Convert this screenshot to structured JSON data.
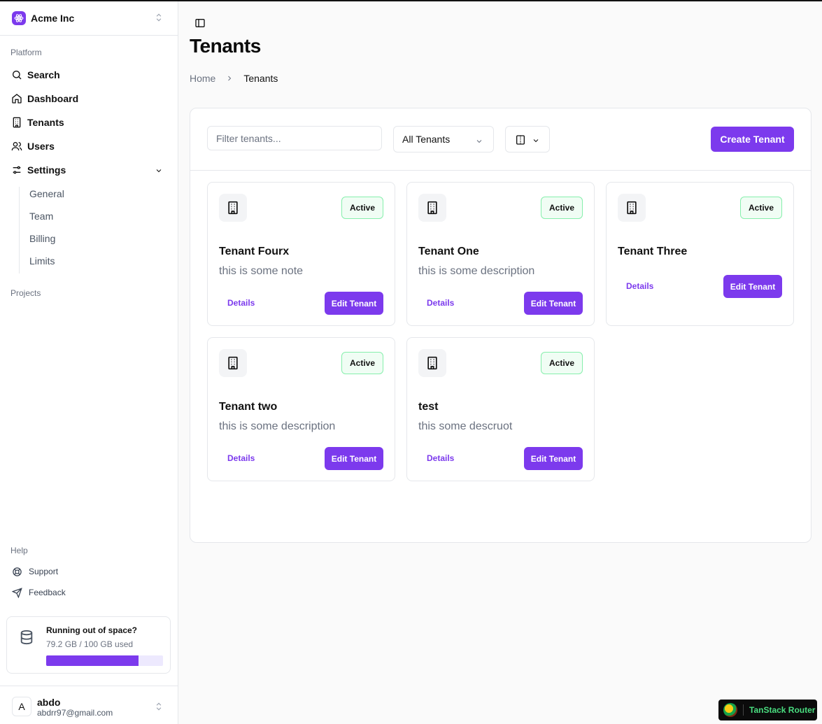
{
  "org": {
    "name": "Acme Inc"
  },
  "sidebar": {
    "platform_label": "Platform",
    "items": [
      {
        "label": "Search",
        "icon": "search-icon"
      },
      {
        "label": "Dashboard",
        "icon": "home-icon"
      },
      {
        "label": "Tenants",
        "icon": "building-icon"
      },
      {
        "label": "Users",
        "icon": "users-icon"
      },
      {
        "label": "Settings",
        "icon": "settings-sliders-icon"
      }
    ],
    "settings_sub": [
      "General",
      "Team",
      "Billing",
      "Limits"
    ],
    "projects_label": "Projects",
    "help_label": "Help",
    "help_items": [
      {
        "label": "Support",
        "icon": "life-buoy-icon"
      },
      {
        "label": "Feedback",
        "icon": "send-icon"
      }
    ],
    "storage": {
      "title": "Running out of space?",
      "usage": "79.2 GB / 100 GB used",
      "fraction": 0.792
    },
    "user": {
      "initial": "A",
      "name": "abdo",
      "email": "abdrr97@gmail.com"
    }
  },
  "page": {
    "title": "Tenants",
    "breadcrumb": {
      "home": "Home",
      "current": "Tenants"
    }
  },
  "toolbar": {
    "filter_placeholder": "Filter tenants...",
    "filter_value": "",
    "select_value": "All Tenants",
    "create_label": "Create Tenant"
  },
  "tenants": [
    {
      "name": "Tenant Fourx",
      "description": "this is some note",
      "status": "Active",
      "details": "Details",
      "edit": "Edit Tenant"
    },
    {
      "name": "Tenant One",
      "description": "this is some description",
      "status": "Active",
      "details": "Details",
      "edit": "Edit Tenant"
    },
    {
      "name": "Tenant Three",
      "description": "",
      "status": "Active",
      "details": "Details",
      "edit": "Edit Tenant"
    },
    {
      "name": "Tenant two",
      "description": "this is some description",
      "status": "Active",
      "details": "Details",
      "edit": "Edit Tenant"
    },
    {
      "name": "test",
      "description": "this some descruot",
      "status": "Active",
      "details": "Details",
      "edit": "Edit Tenant"
    }
  ],
  "devtools": {
    "label": "TanStack Router"
  },
  "colors": {
    "accent": "#7c3aed",
    "badge_border": "#86efac",
    "badge_bg": "#f0fdf4"
  }
}
